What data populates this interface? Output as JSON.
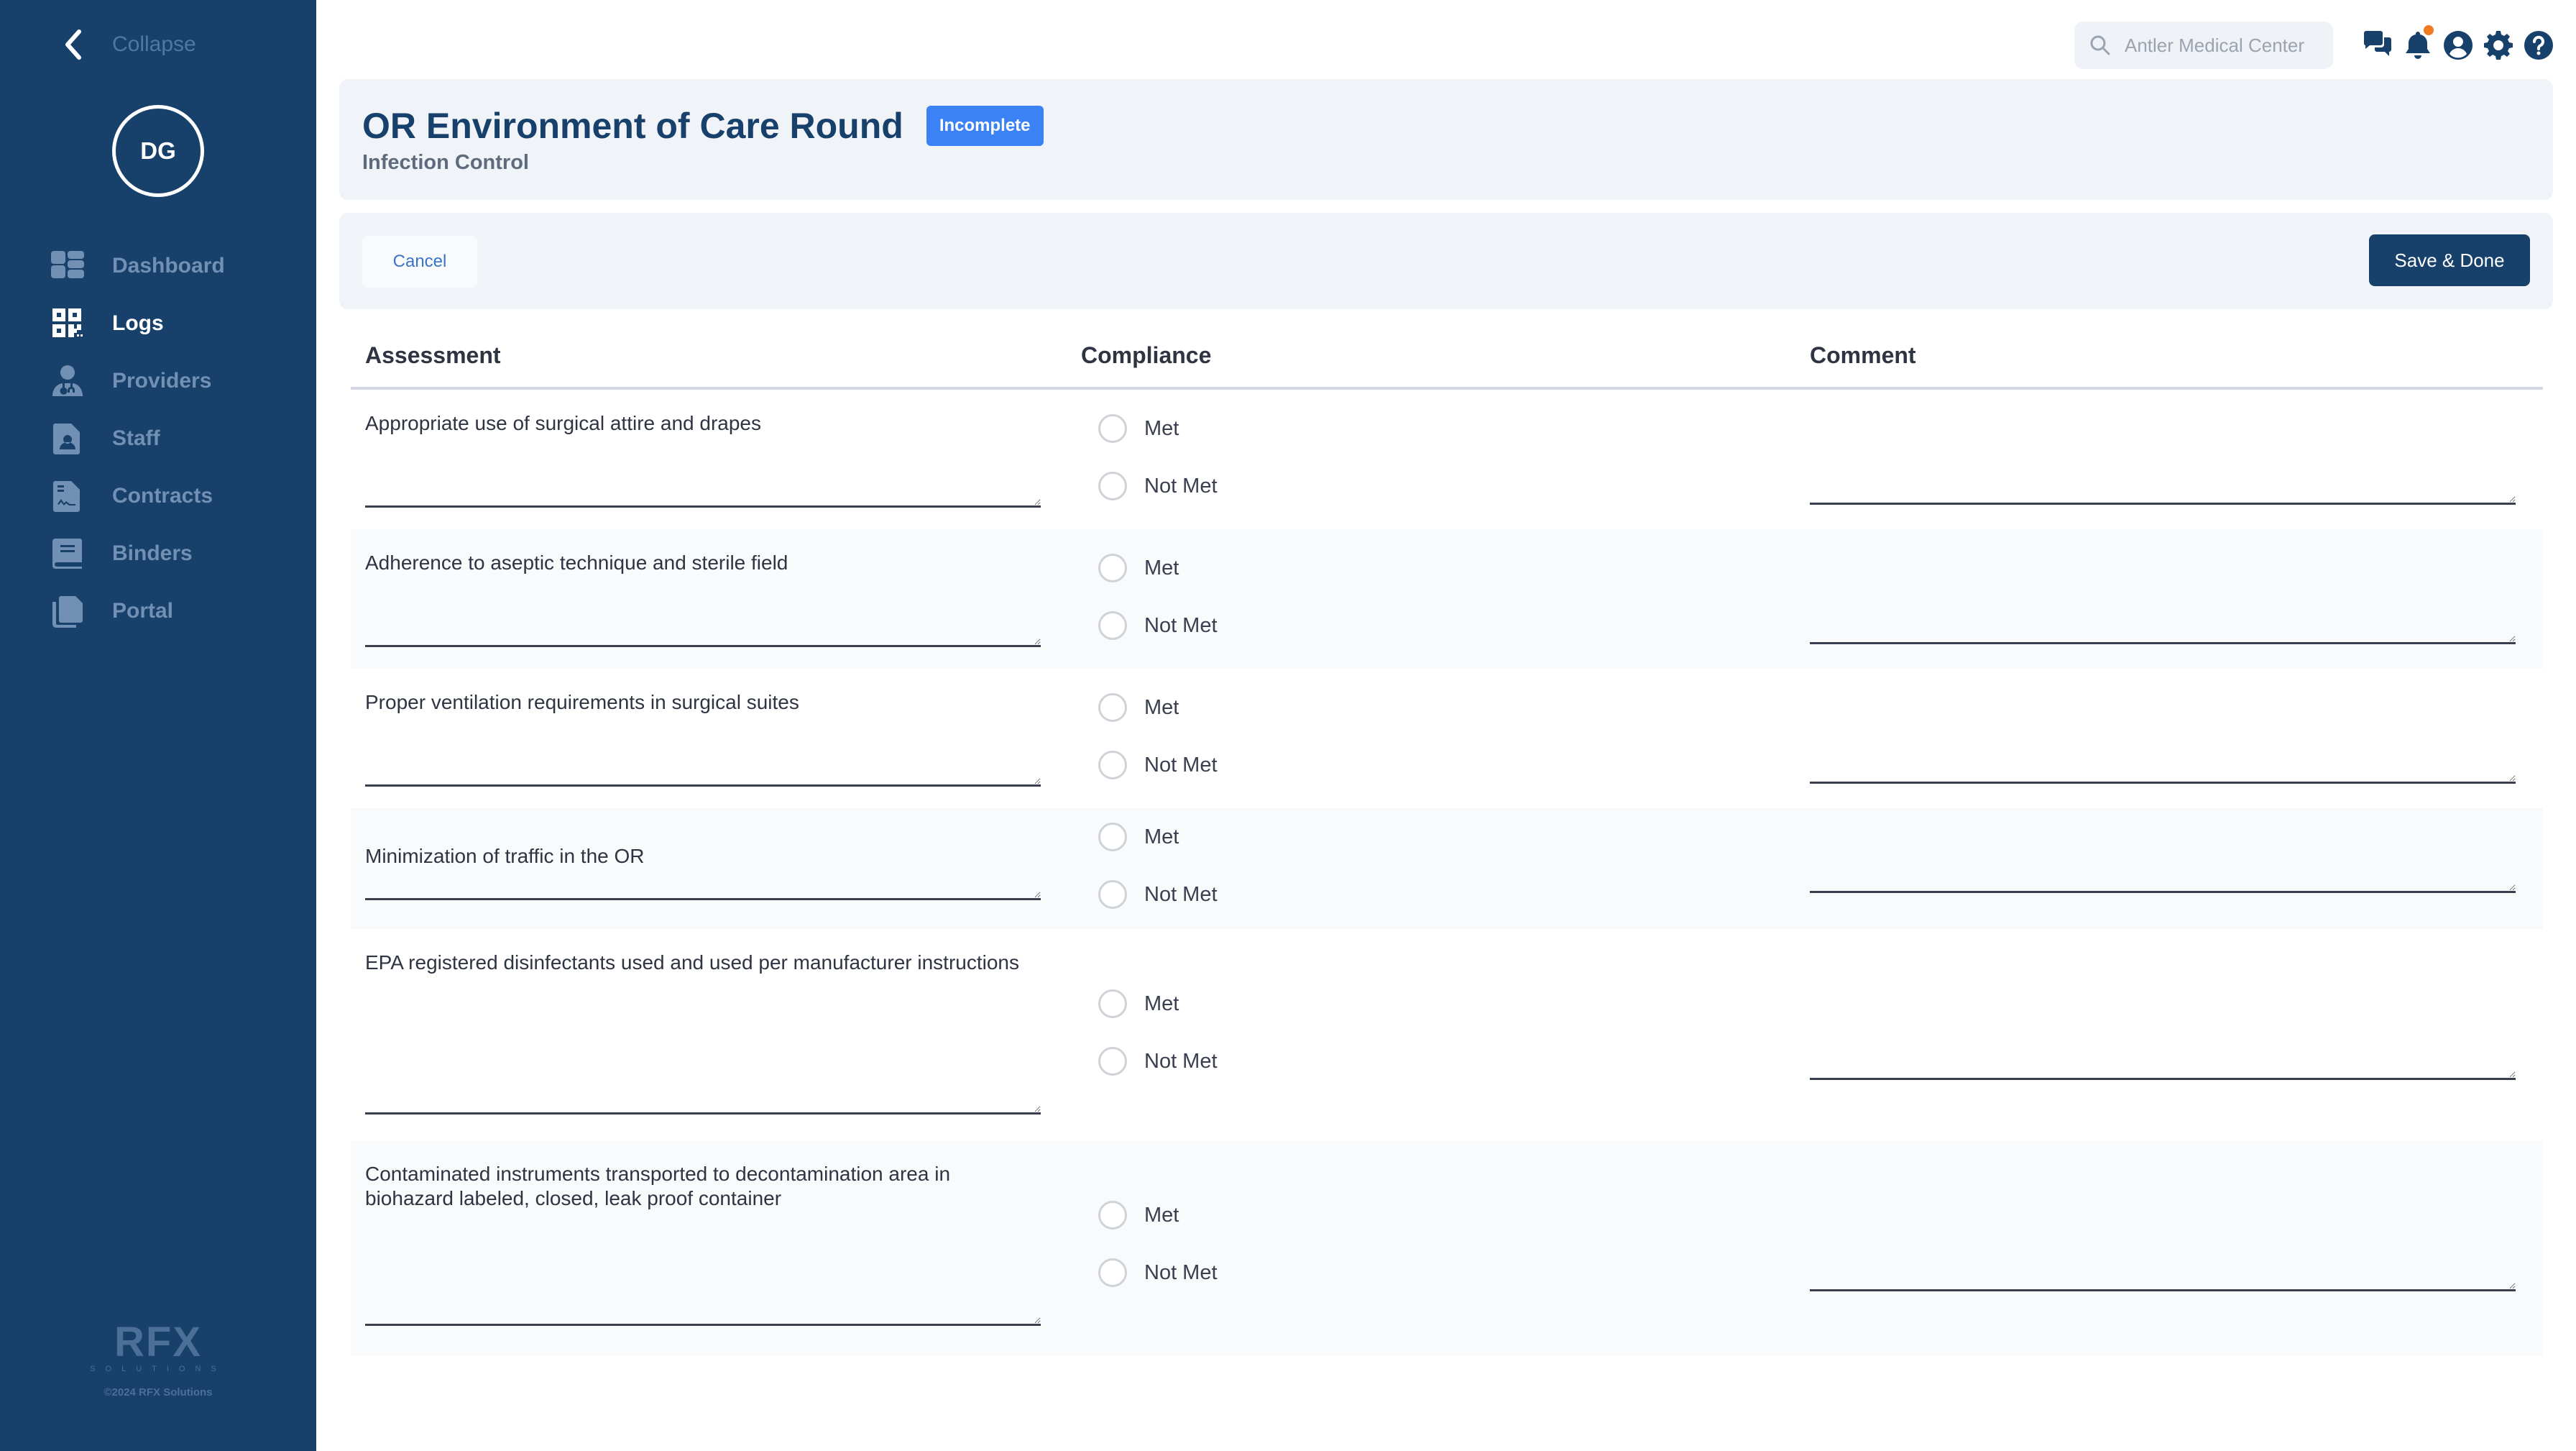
{
  "sidebar": {
    "collapse_label": "Collapse",
    "avatar_initials": "DG",
    "items": [
      {
        "label": "Dashboard",
        "icon": "dashboard-icon",
        "active": false
      },
      {
        "label": "Logs",
        "icon": "qr-code-icon",
        "active": true
      },
      {
        "label": "Providers",
        "icon": "doctor-icon",
        "active": false
      },
      {
        "label": "Staff",
        "icon": "id-file-icon",
        "active": false
      },
      {
        "label": "Contracts",
        "icon": "contract-file-icon",
        "active": false
      },
      {
        "label": "Binders",
        "icon": "book-icon",
        "active": false
      },
      {
        "label": "Portal",
        "icon": "copy-files-icon",
        "active": false
      }
    ],
    "brand_logo": "RFX",
    "brand_sub": "SOLUTIONS",
    "copyright": "©2024 RFX Solutions"
  },
  "topbar": {
    "search_placeholder": "Antler Medical Center",
    "icons": [
      "chat-icon",
      "bell-icon",
      "user-circle-icon",
      "gear-icon",
      "help-icon"
    ],
    "notification_dot_color": "#f07a22"
  },
  "header": {
    "title": "OR Environment of Care Round",
    "status": "Incomplete",
    "subtitle": "Infection Control"
  },
  "actions": {
    "cancel_label": "Cancel",
    "save_label": "Save & Done"
  },
  "table": {
    "columns": [
      "Assessment",
      "Compliance",
      "Comment"
    ],
    "options": [
      "Met",
      "Not Met"
    ],
    "rows": [
      {
        "assessment": "Appropriate use of surgical attire and drapes",
        "selected": null,
        "note": "",
        "comment": ""
      },
      {
        "assessment": "Adherence to aseptic technique and sterile field",
        "selected": null,
        "note": "",
        "comment": ""
      },
      {
        "assessment": "Proper ventilation requirements in surgical suites",
        "selected": null,
        "note": "",
        "comment": ""
      },
      {
        "assessment": "Minimization of traffic in the OR",
        "selected": null,
        "note": "",
        "comment": ""
      },
      {
        "assessment": "EPA registered disinfectants used and used per manufacturer instructions",
        "selected": null,
        "note": "",
        "comment": ""
      },
      {
        "assessment": "Contaminated instruments transported to decontamination area in biohazard labeled, closed, leak proof container",
        "selected": null,
        "note": "",
        "comment": ""
      }
    ]
  },
  "colors": {
    "sidebar_bg": "#17406b",
    "brand": "#17406b",
    "badge": "#3b82f6",
    "accent_link": "#3b74c6"
  }
}
